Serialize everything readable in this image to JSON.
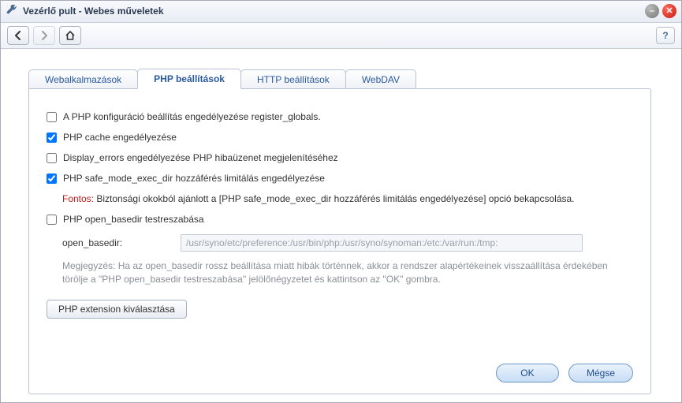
{
  "window": {
    "title": "Vezérlő pult - Webes műveletek"
  },
  "toolbar": {
    "help": "?"
  },
  "tabs": [
    {
      "label": "Webalkalmazások"
    },
    {
      "label": "PHP beállítások"
    },
    {
      "label": "HTTP beállítások"
    },
    {
      "label": "WebDAV"
    }
  ],
  "options": {
    "register_globals": {
      "label": "A PHP konfiguráció beállítás engedélyezése register_globals.",
      "checked": false
    },
    "php_cache": {
      "label": "PHP cache engedélyezése",
      "checked": true
    },
    "display_errors": {
      "label": "Display_errors engedélyezése PHP hibaüzenet megjelenítéséhez",
      "checked": false
    },
    "safe_mode": {
      "label": "PHP safe_mode_exec_dir hozzáférés limitálás engedélyezése",
      "checked": true
    },
    "safe_mode_note_prefix": "Fontos:",
    "safe_mode_note": " Biztonsági okokból ajánlott a [PHP safe_mode_exec_dir hozzáférés limitálás engedélyezése] opció bekapcsolása.",
    "open_basedir_custom": {
      "label": "PHP open_basedir testreszabása",
      "checked": false
    },
    "open_basedir_label": "open_basedir:",
    "open_basedir_value": "/usr/syno/etc/preference:/usr/bin/php:/usr/syno/synoman:/etc:/var/run:/tmp:",
    "open_basedir_note": "Megjegyzés: Ha az open_basedir rossz beállítása miatt hibák történnek, akkor a rendszer alapértékeinek visszaállítása érdekében törölje a \"PHP open_basedir testreszabása\" jelölőnégyzetet és kattintson az \"OK\" gombra.",
    "ext_button": "PHP extension kiválasztása"
  },
  "buttons": {
    "ok": "OK",
    "cancel": "Mégse"
  }
}
